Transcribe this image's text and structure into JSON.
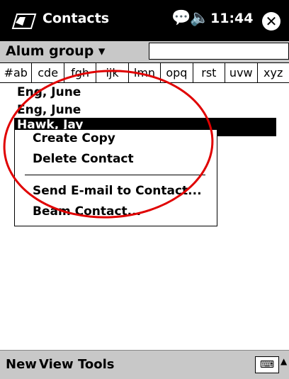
{
  "titlebar": {
    "title": "Contacts",
    "time": "11:44",
    "close_label": "✕"
  },
  "filter": {
    "group_label": "Alum group ▾",
    "search_value": ""
  },
  "tabs": [
    "#ab",
    "cde",
    "fgh",
    "ijk",
    "lmn",
    "opq",
    "rst",
    "uvw",
    "xyz"
  ],
  "contacts": [
    "Eng, June",
    "Eng, June",
    "Hawk, Jay"
  ],
  "context_menu": {
    "items": [
      "Create Copy",
      "Delete Contact",
      "Send E-mail to Contact...",
      "Beam Contact..."
    ]
  },
  "menubar": {
    "new": "New",
    "view": "View",
    "tools": "Tools"
  },
  "icons": {
    "start": "windows-flag-icon",
    "notification": "speech-bubble-icon",
    "volume": "speaker-icon",
    "keyboard": "keyboard-icon"
  },
  "colors": {
    "annotation_oval": "#e00000",
    "bar": "#c8c8c8"
  }
}
